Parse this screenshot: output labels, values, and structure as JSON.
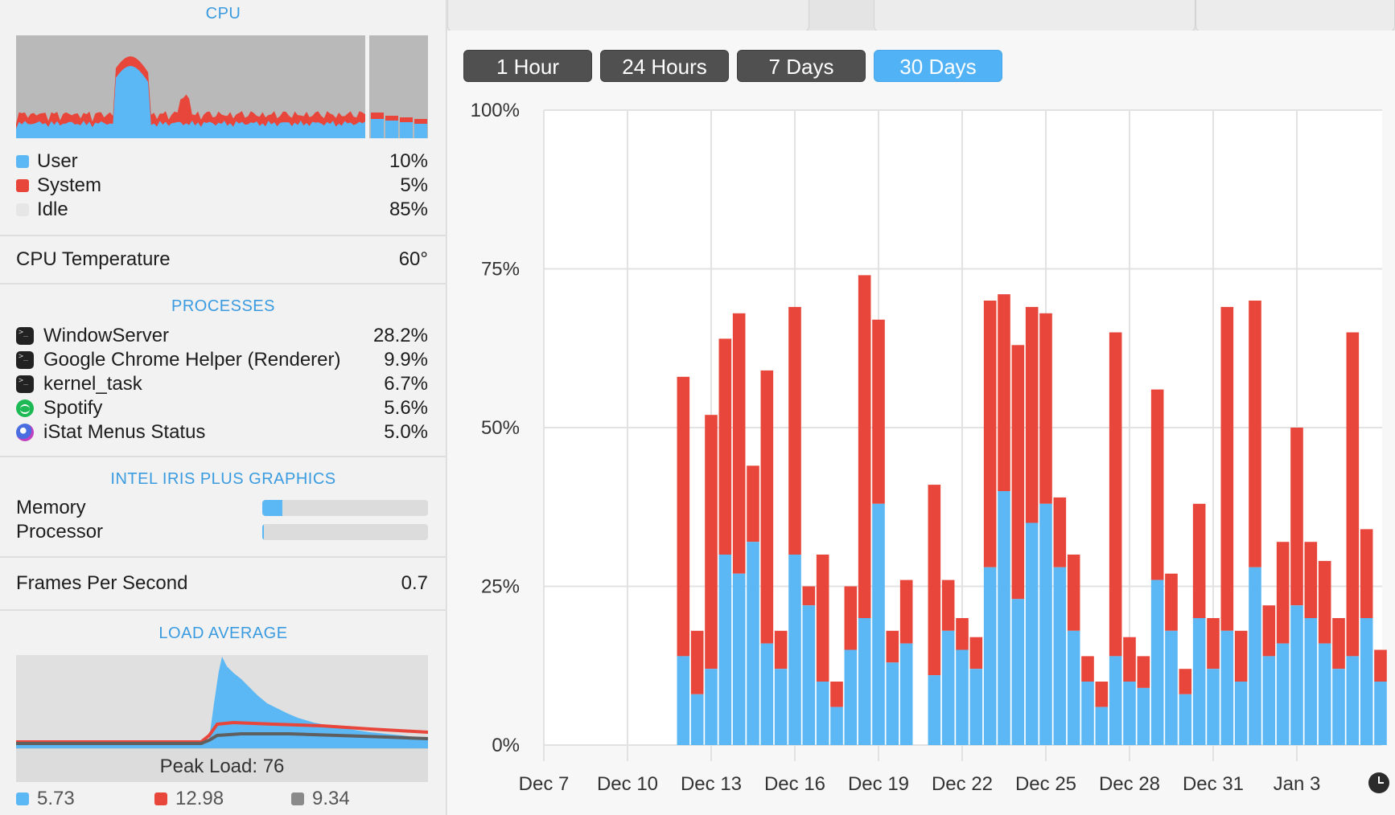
{
  "cpu": {
    "title": "CPU",
    "legend": [
      {
        "label": "User",
        "value": "10%",
        "color": "#5bb8f5"
      },
      {
        "label": "System",
        "value": "5%",
        "color": "#e8463a"
      },
      {
        "label": "Idle",
        "value": "85%",
        "color": "#e6e6e6"
      }
    ],
    "temperature_label": "CPU Temperature",
    "temperature_value": "60°"
  },
  "processes": {
    "title": "PROCESSES",
    "items": [
      {
        "name": "WindowServer",
        "value": "28.2%",
        "icon": "terminal-icon"
      },
      {
        "name": "Google Chrome Helper (Renderer)",
        "value": "9.9%",
        "icon": "terminal-icon"
      },
      {
        "name": "kernel_task",
        "value": "6.7%",
        "icon": "terminal-icon"
      },
      {
        "name": "Spotify",
        "value": "5.6%",
        "icon": "spotify-icon"
      },
      {
        "name": "iStat Menus Status",
        "value": "5.0%",
        "icon": "istat-icon"
      }
    ]
  },
  "gpu": {
    "title": "INTEL IRIS PLUS GRAPHICS",
    "memory_label": "Memory",
    "memory_level": 0.12,
    "processor_label": "Processor",
    "processor_level": 0.01,
    "fps_label": "Frames Per Second",
    "fps_value": "0.7"
  },
  "load": {
    "title": "LOAD AVERAGE",
    "peak": "Peak Load: 76",
    "legend": [
      {
        "value": "5.73",
        "color": "#5bb8f5"
      },
      {
        "value": "12.98",
        "color": "#e8463a"
      },
      {
        "value": "9.34",
        "color": "#8a8a8a"
      }
    ]
  },
  "history": {
    "tabs": [
      "1 Hour",
      "24 Hours",
      "7 Days",
      "30 Days"
    ],
    "active_tab": 3
  },
  "chart_data": {
    "type": "area",
    "title": "",
    "xlabel": "",
    "ylabel": "",
    "ylim": [
      0,
      100
    ],
    "yticks": [
      "0%",
      "25%",
      "50%",
      "75%",
      "100%"
    ],
    "xticks": [
      "Dec 7",
      "Dec 10",
      "Dec 13",
      "Dec 16",
      "Dec 19",
      "Dec 22",
      "Dec 25",
      "Dec 28",
      "Dec 31",
      "Jan 3"
    ],
    "grid": true,
    "series": [
      {
        "name": "User",
        "color": "#5bb8f5",
        "x": [
          12.0,
          12.5,
          13.0,
          13.5,
          14.0,
          14.5,
          15.0,
          15.5,
          16.0,
          16.5,
          17.0,
          17.5,
          18.0,
          18.5,
          19.0,
          19.5,
          20.0,
          21.0,
          21.5,
          22.0,
          22.5,
          23.0,
          23.5,
          24.0,
          24.5,
          25.0,
          25.5,
          26.0,
          26.5,
          27.0,
          27.5,
          28.0,
          28.5,
          29.0,
          29.5,
          30.0,
          30.5,
          31.0,
          31.5,
          32.0,
          32.5,
          33.0,
          33.5,
          34.0,
          34.5,
          35.0,
          35.5,
          36.0,
          36.5,
          37.0
        ],
        "y": [
          14,
          8,
          12,
          30,
          27,
          32,
          16,
          12,
          30,
          22,
          10,
          6,
          15,
          20,
          38,
          13,
          16,
          11,
          18,
          15,
          12,
          28,
          40,
          23,
          35,
          38,
          28,
          18,
          10,
          6,
          14,
          10,
          9,
          26,
          18,
          8,
          20,
          12,
          18,
          10,
          28,
          14,
          16,
          22,
          20,
          16,
          12,
          14,
          20,
          10
        ]
      },
      {
        "name": "System",
        "color": "#e8463a",
        "x": [
          12.0,
          12.5,
          13.0,
          13.5,
          14.0,
          14.5,
          15.0,
          15.5,
          16.0,
          16.5,
          17.0,
          17.5,
          18.0,
          18.5,
          19.0,
          19.5,
          20.0,
          21.0,
          21.5,
          22.0,
          22.5,
          23.0,
          23.5,
          24.0,
          24.5,
          25.0,
          25.5,
          26.0,
          26.5,
          27.0,
          27.5,
          28.0,
          28.5,
          29.0,
          29.5,
          30.0,
          30.5,
          31.0,
          31.5,
          32.0,
          32.5,
          33.0,
          33.5,
          34.0,
          34.5,
          35.0,
          35.5,
          36.0,
          36.5,
          37.0
        ],
        "y": [
          44,
          10,
          40,
          34,
          41,
          12,
          43,
          6,
          39,
          3,
          20,
          4,
          10,
          54,
          29,
          5,
          10,
          30,
          8,
          5,
          5,
          42,
          31,
          40,
          34,
          30,
          11,
          12,
          4,
          4,
          51,
          7,
          5,
          30,
          9,
          4,
          18,
          8,
          51,
          8,
          42,
          8,
          16,
          28,
          12,
          13,
          8,
          51,
          14,
          5
        ]
      }
    ]
  }
}
